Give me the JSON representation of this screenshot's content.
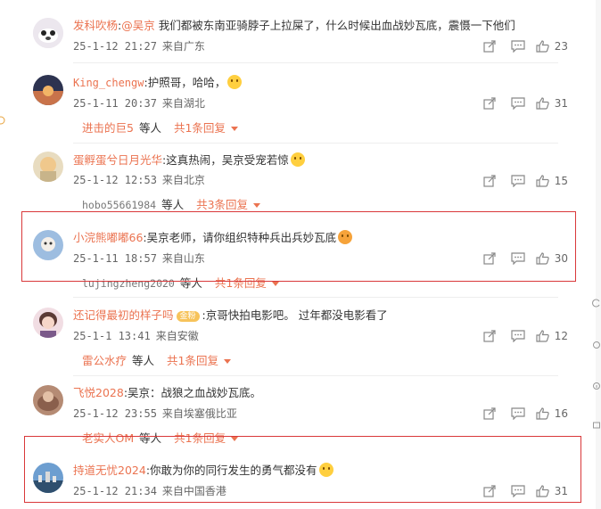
{
  "comments": [
    {
      "user": "发科吹杨",
      "mention": "@吴京",
      "text": " 我们都被东南亚骑脖子上拉屎了，什么时候出血战妙瓦底，震慑一下他们",
      "date": "25-1-12 21:27",
      "location": "来自广东",
      "likes": "23",
      "avatar_color": "#e9e4ea"
    },
    {
      "user": "King_chengw",
      "text": ":护照哥，哈哈，",
      "date": "25-1-11 20:37",
      "location": "来自湖北",
      "likes": "31",
      "avatar_color": "#3b3f5c",
      "reply": {
        "name": "进击的巨5",
        "etc": "等人",
        "total": "共1条回复"
      }
    },
    {
      "user": "蛋孵蛋兮日月光华",
      "text": ":这真热闹，吴京受宠若惊",
      "date": "25-1-12 12:53",
      "location": "来自北京",
      "likes": "15",
      "avatar_color": "#d8c9a0",
      "reply": {
        "name": "hobo55661984",
        "etc": "等人",
        "total": "共3条回复"
      }
    },
    {
      "user": "小浣熊嘟嘟66",
      "text": ":吴京老师，请你组织特种兵出兵妙瓦底",
      "date": "25-1-11 18:57",
      "location": "来自山东",
      "likes": "30",
      "avatar_color": "#a9c3e0",
      "reply": {
        "name": "lujingzheng2020",
        "etc": "等人",
        "total": "共1条回复"
      }
    },
    {
      "user": "还记得最初的样子吗",
      "badge": "金粉",
      "text": ":京哥快拍电影吧。  过年都没电影看了",
      "date": "25-1-1 13:41",
      "location": "来自安徽",
      "likes": "12",
      "avatar_color": "#e7c7d1",
      "reply": {
        "name": "雷公水疗",
        "etc": "等人",
        "total": "共1条回复"
      }
    },
    {
      "user": "飞悦2028",
      "text": ":吴京：战狼之血战妙瓦底。",
      "date": "25-1-12 23:55",
      "location": "来自埃塞俄比亚",
      "likes": "16",
      "avatar_color": "#a27c6a",
      "reply": {
        "name": "老实人OM",
        "etc": "等人",
        "total": "共1条回复"
      }
    },
    {
      "user": "持道无忧2024",
      "text": ":你敢为你的同行发生的勇气都没有",
      "date": "25-1-12 21:34",
      "location": "来自中国香港",
      "likes": "31",
      "avatar_color": "#3f6f9b"
    }
  ],
  "icons": {
    "share": "share-icon",
    "comment": "comment-icon",
    "like": "thumbs-up-icon"
  },
  "colors": {
    "username": "#eb7350",
    "highlight_box": "#d9383a"
  }
}
